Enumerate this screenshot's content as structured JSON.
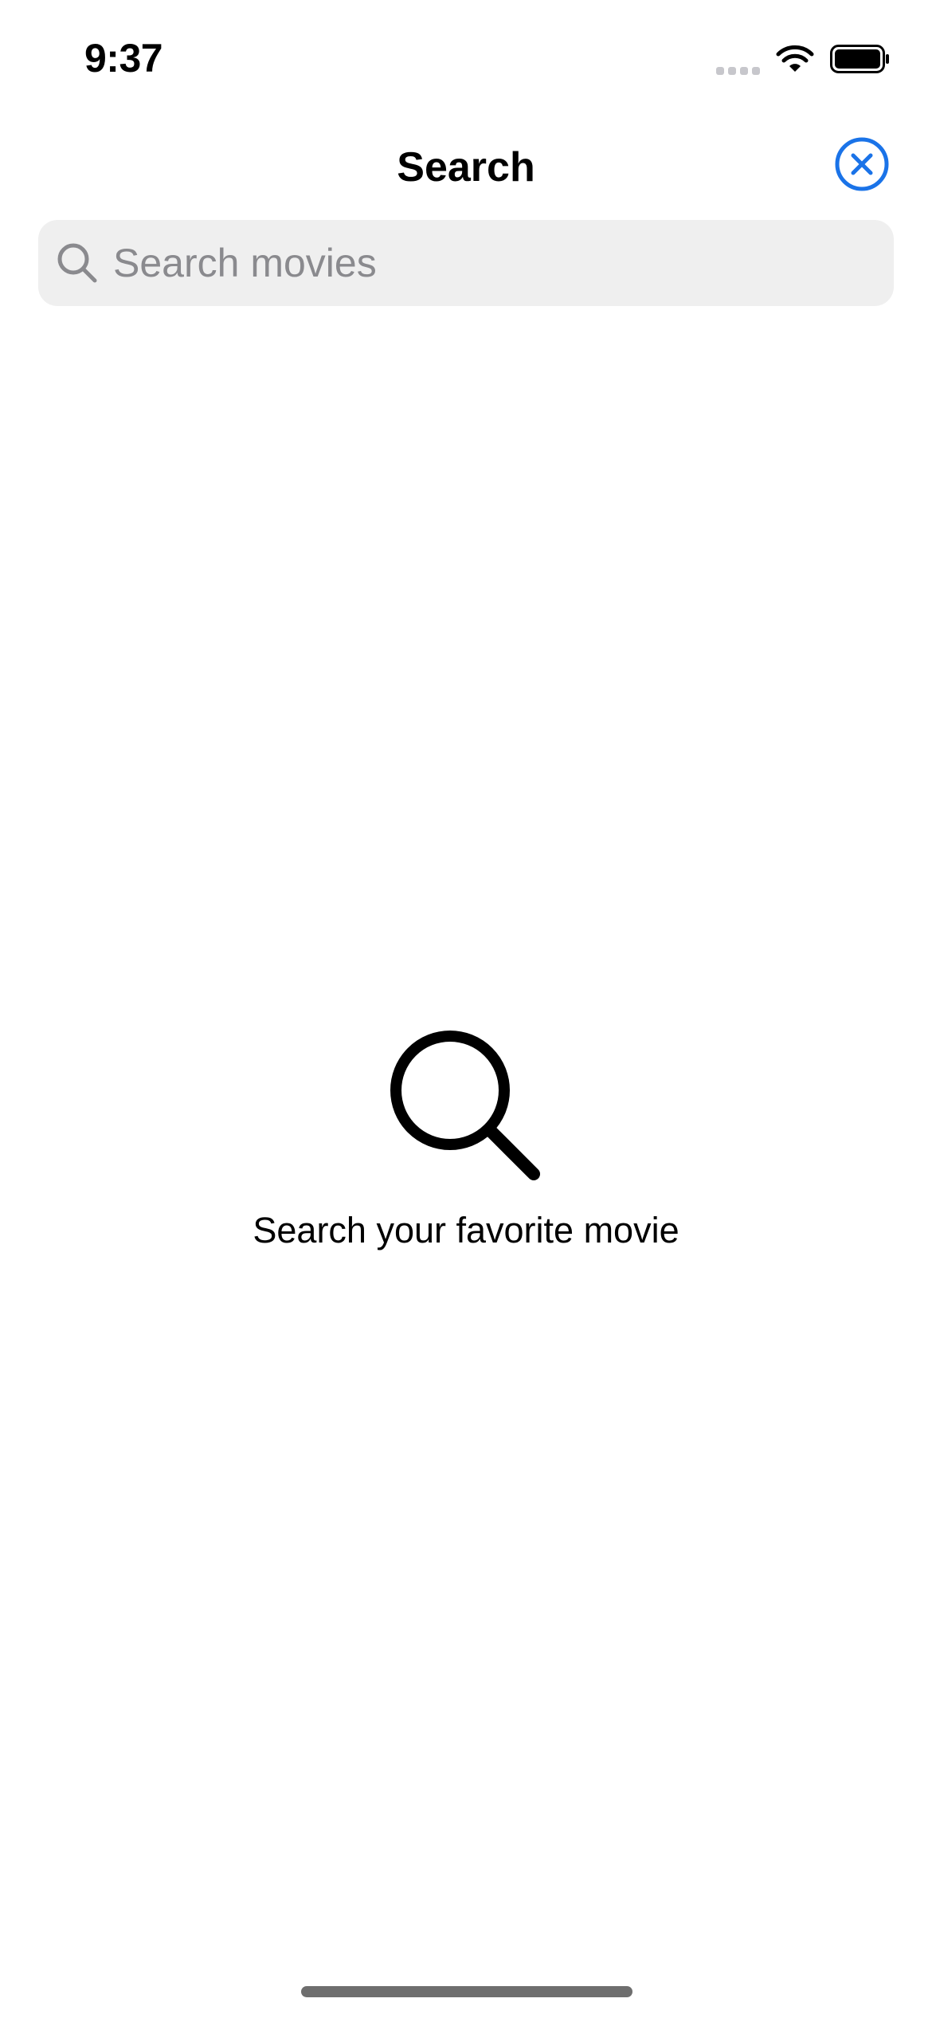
{
  "status_bar": {
    "time": "9:37",
    "icons": [
      "signal-icon",
      "wifi-icon",
      "battery-icon"
    ]
  },
  "nav": {
    "title": "Search",
    "close_icon": "close-circle-icon"
  },
  "search": {
    "placeholder": "Search movies",
    "value": "",
    "icon": "search-icon"
  },
  "empty_state": {
    "icon": "magnifying-glass-icon",
    "message": "Search your favorite movie"
  },
  "colors": {
    "accent": "#1a73e8",
    "search_bg": "#efefef",
    "placeholder": "#8a8a8e"
  }
}
